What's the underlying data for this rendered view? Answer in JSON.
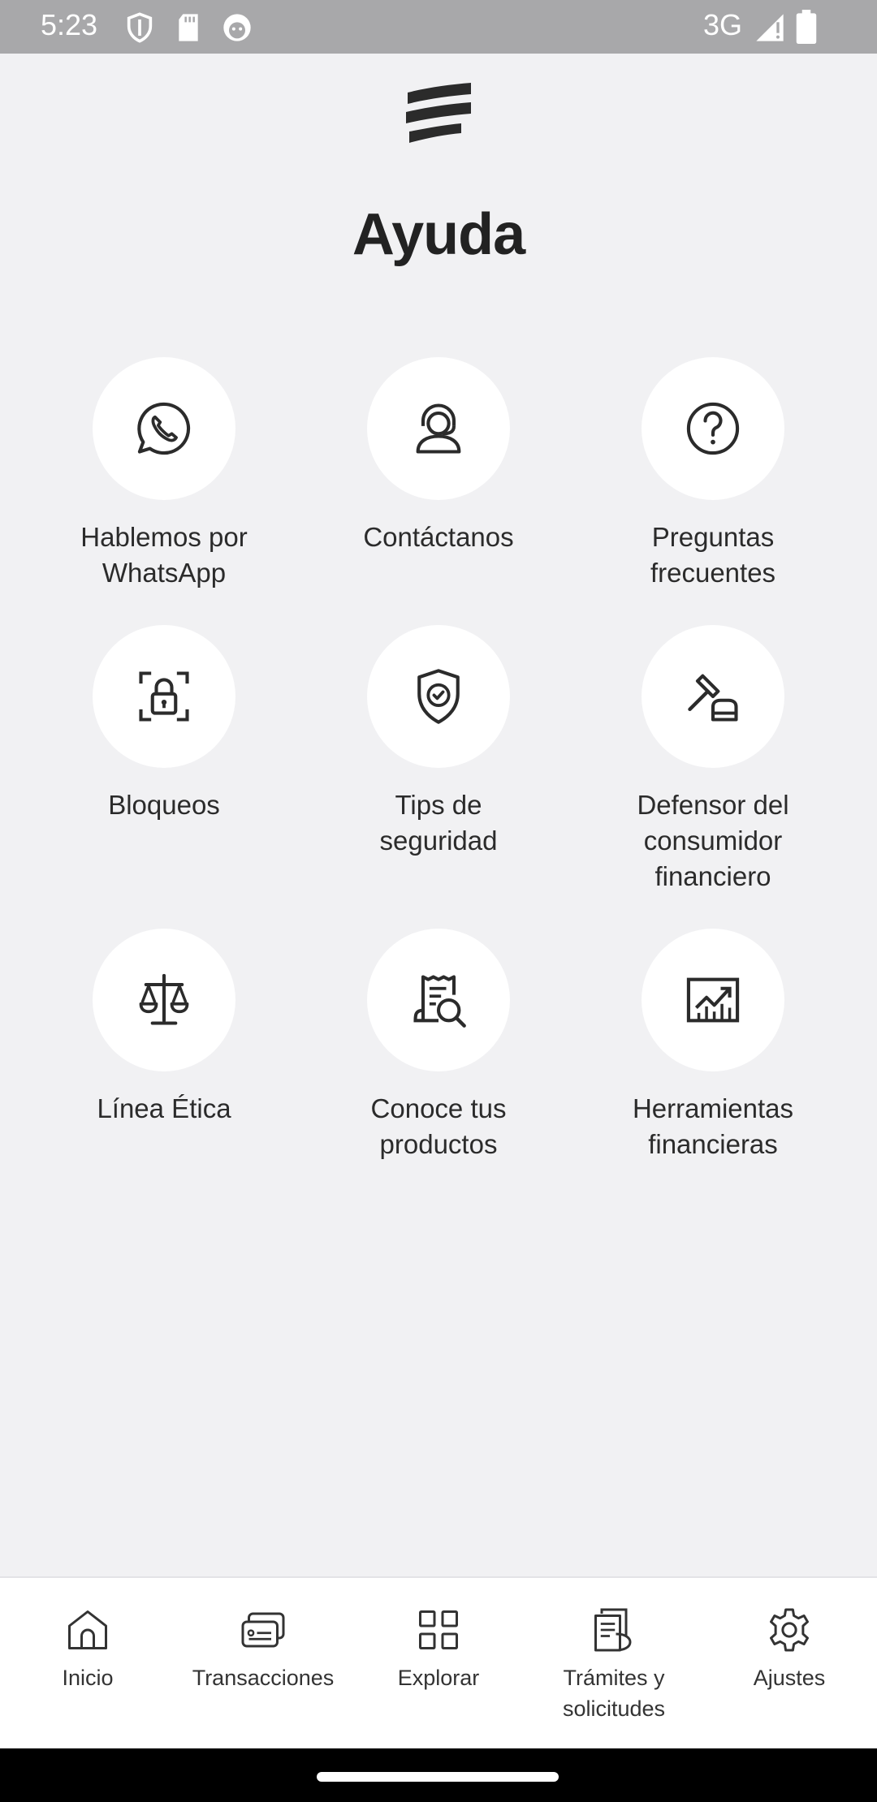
{
  "status_bar": {
    "time": "5:23",
    "network": "3G",
    "icons": [
      "shield-icon",
      "sd-card-icon",
      "android-icon",
      "signal-icon",
      "battery-icon"
    ]
  },
  "header": {
    "logo": "bank-logo-icon",
    "title": "Ayuda"
  },
  "help_options": [
    {
      "label": "Hablemos por\nWhatsApp",
      "icon": "whatsapp-icon"
    },
    {
      "label": "Contáctanos",
      "icon": "headset-agent-icon"
    },
    {
      "label": "Preguntas\nfrecuentes",
      "icon": "question-icon"
    },
    {
      "label": "Bloqueos",
      "icon": "lock-icon"
    },
    {
      "label": "Tips de\nseguridad",
      "icon": "shield-check-icon"
    },
    {
      "label": "Defensor del\nconsumidor\nfinanciero",
      "icon": "gavel-icon"
    },
    {
      "label": "Línea Ética",
      "icon": "scales-icon"
    },
    {
      "label": "Conoce tus\nproductos",
      "icon": "receipt-search-icon"
    },
    {
      "label": "Herramientas\nfinancieras",
      "icon": "chart-up-icon"
    }
  ],
  "bottom_nav": [
    {
      "label": "Inicio",
      "icon": "home-icon"
    },
    {
      "label": "Transacciones",
      "icon": "cards-icon"
    },
    {
      "label": "Explorar",
      "icon": "grid-icon"
    },
    {
      "label": "Trámites y\nsolicitudes",
      "icon": "documents-icon"
    },
    {
      "label": "Ajustes",
      "icon": "gear-icon"
    }
  ],
  "colors": {
    "background": "#f1f1f3",
    "status_bar": "#a8a8aa",
    "circle": "#ffffff",
    "text": "#2b2b2b"
  }
}
